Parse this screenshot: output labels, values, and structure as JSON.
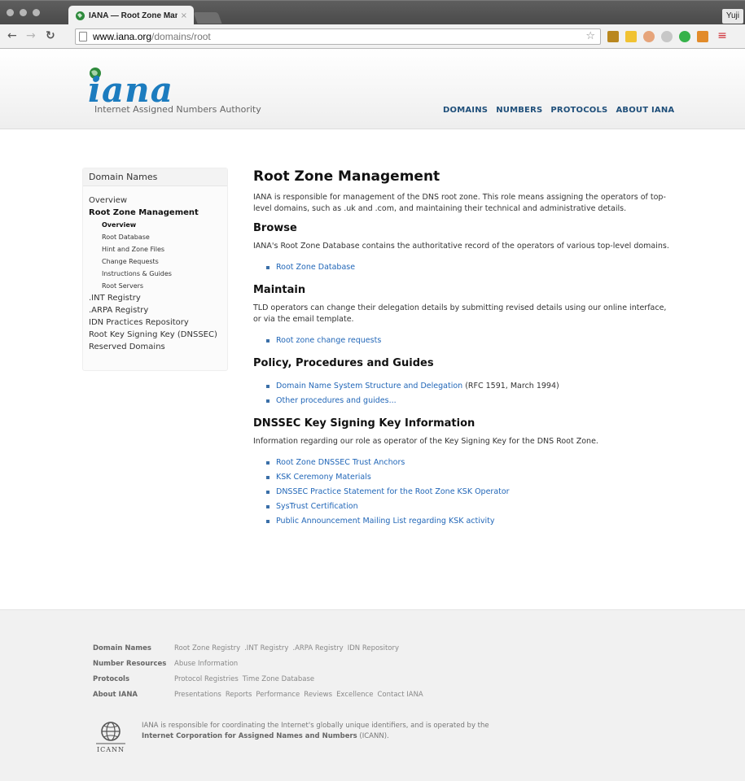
{
  "browser": {
    "tab_title": "IANA — Root Zone Manag",
    "tab_close": "×",
    "profile_name": "Yuji",
    "url_host": "www.iana.org",
    "url_path": "/domains/root"
  },
  "header": {
    "logo_word": "iana",
    "logo_subtitle": "Internet Assigned Numbers Authority",
    "nav": [
      "DOMAINS",
      "NUMBERS",
      "PROTOCOLS",
      "ABOUT IANA"
    ]
  },
  "sidebar": {
    "heading": "Domain Names",
    "items": [
      {
        "label": "Overview",
        "level": "top"
      },
      {
        "label": "Root Zone Management",
        "level": "active"
      },
      {
        "label": "Overview",
        "level": "sub-current"
      },
      {
        "label": "Root Database",
        "level": "sub"
      },
      {
        "label": "Hint and Zone Files",
        "level": "sub"
      },
      {
        "label": "Change Requests",
        "level": "sub"
      },
      {
        "label": "Instructions & Guides",
        "level": "sub"
      },
      {
        "label": "Root Servers",
        "level": "sub"
      },
      {
        "label": ".INT Registry",
        "level": "top"
      },
      {
        "label": ".ARPA Registry",
        "level": "top"
      },
      {
        "label": "IDN Practices Repository",
        "level": "top"
      },
      {
        "label": "Root Key Signing Key (DNSSEC)",
        "level": "top"
      },
      {
        "label": "Reserved Domains",
        "level": "top"
      }
    ]
  },
  "main": {
    "title": "Root Zone Management",
    "intro": "IANA is responsible for management of the DNS root zone. This role means assigning the operators of top-level domains, such as .uk and .com, and maintaining their technical and administrative details.",
    "browse": {
      "heading": "Browse",
      "text": "IANA's Root Zone Database contains the authoritative record of the operators of various top-level domains.",
      "links": [
        "Root Zone Database"
      ]
    },
    "maintain": {
      "heading": "Maintain",
      "text": "TLD operators can change their delegation details by submitting revised details using our online interface, or via the email template.",
      "links": [
        "Root zone change requests"
      ]
    },
    "policy": {
      "heading": "Policy, Procedures and Guides",
      "link1": "Domain Name System Structure and Delegation",
      "link1_suffix": " (RFC 1591, March 1994)",
      "link2": "Other procedures and guides..."
    },
    "dnssec": {
      "heading": "DNSSEC Key Signing Key Information",
      "text": "Information regarding our role as operator of the Key Signing Key for the DNS Root Zone.",
      "links": [
        "Root Zone DNSSEC Trust Anchors",
        "KSK Ceremony Materials",
        "DNSSEC Practice Statement for the Root Zone KSK Operator",
        "SysTrust Certification",
        "Public Announcement Mailing List regarding KSK activity"
      ]
    }
  },
  "footer": {
    "rows": [
      {
        "heading": "Domain Names",
        "links": [
          "Root Zone Registry",
          ".INT Registry",
          ".ARPA Registry",
          "IDN Repository"
        ]
      },
      {
        "heading": "Number Resources",
        "links": [
          "Abuse Information"
        ]
      },
      {
        "heading": "Protocols",
        "links": [
          "Protocol Registries",
          "Time Zone Database"
        ]
      },
      {
        "heading": "About IANA",
        "links": [
          "Presentations",
          "Reports",
          "Performance",
          "Reviews",
          "Excellence",
          "Contact IANA"
        ]
      }
    ],
    "icann_label": "ICANN",
    "icann_line1": "IANA is responsible for coordinating the Internet's globally unique identifiers, and is operated by the",
    "icann_org": "Internet Corporation for Assigned Names and Numbers",
    "icann_suffix": " (ICANN)."
  },
  "colors": {
    "link": "#2267b8",
    "logo": "#1c7cbf",
    "nav": "#1f4f7a"
  }
}
